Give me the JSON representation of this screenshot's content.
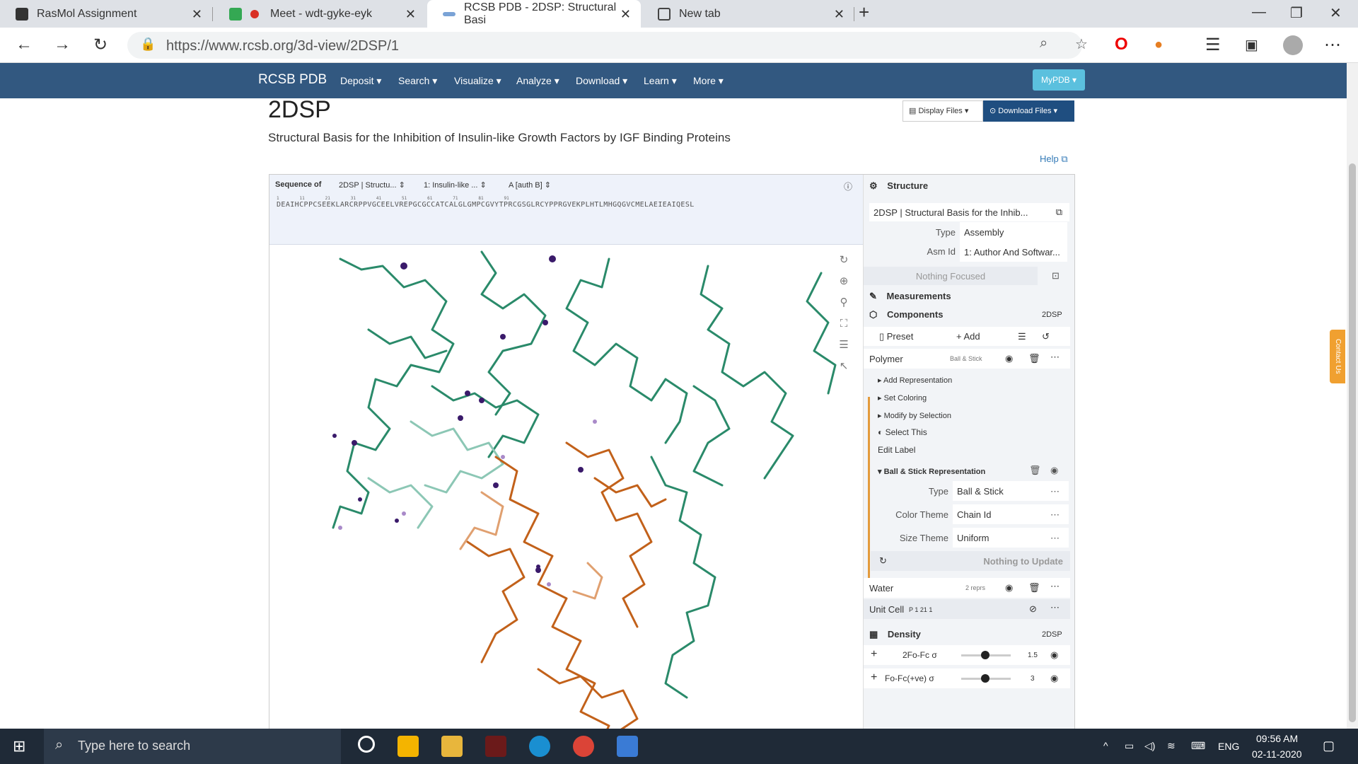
{
  "browser": {
    "tabs": [
      {
        "label": "RasMol Assignment"
      },
      {
        "label": "Meet - wdt-gyke-eyk"
      },
      {
        "label": "RCSB PDB - 2DSP: Structural Basi"
      },
      {
        "label": "New tab"
      }
    ],
    "url": "https://www.rcsb.org/3d-view/2DSP/1"
  },
  "sitenav": {
    "brand": "RCSB PDB",
    "items": [
      "Deposit ▾",
      "Search ▾",
      "Visualize ▾",
      "Analyze ▾",
      "Download ▾",
      "Learn ▾",
      "More ▾"
    ],
    "mypdb": "MyPDB ▾"
  },
  "page": {
    "title": "2DSP",
    "subtitle": "Structural Basis for the Inhibition of Insulin-like Growth Factors by IGF Binding Proteins",
    "display_files": "Display Files ▾",
    "download_files": "Download Files ▾",
    "help": "Help"
  },
  "sequence": {
    "label": "Sequence of",
    "entry": "2DSP | Structu...",
    "entity": "1: Insulin-like ...",
    "chain": "A [auth B]",
    "numbers": "1        11        21        31        41        51        61        71        81        91",
    "text": "DEAIHCPPCSEEKLARCRPPVGCEELVREPGCGCCATCALGLGMPCGVYTPRCGSGLRCYPPRGVEKPLHTLMHGQGVCMELAEIEAIQESL"
  },
  "panel": {
    "structure_header": "Structure",
    "structure_name": "2DSP | Structural Basis for the Inhib...",
    "type_label": "Type",
    "type_value": "Assembly",
    "asm_label": "Asm Id",
    "asm_value": "1: Author And Softwar...",
    "focus": "Nothing Focused",
    "measurements": "Measurements",
    "components": "Components",
    "components_tag": "2DSP",
    "preset": "Preset",
    "add": "+ Add",
    "polymer": "Polymer",
    "polymer_repr": "Ball & Stick",
    "add_repr": "Add Representation",
    "set_coloring": "Set Coloring",
    "modify_sel": "Modify by Selection",
    "select_this": "Select This",
    "edit_label": "Edit Label",
    "bs_repr": "Ball & Stick Representation",
    "r_type_label": "Type",
    "r_type_value": "Ball & Stick",
    "r_color_label": "Color Theme",
    "r_color_value": "Chain Id",
    "r_size_label": "Size Theme",
    "r_size_value": "Uniform",
    "nothing_update": "Nothing to Update",
    "water": "Water",
    "water_reprs": "2 reprs",
    "unit_cell": "Unit Cell",
    "unit_cell_sg": "P 1 21 1",
    "density": "Density",
    "density_tag": "2DSP",
    "d1_label": "2Fo-Fc σ",
    "d1_value": "1.5",
    "d2_label": "Fo-Fc(+ve) σ",
    "d2_value": "3"
  },
  "contact": "Contact Us",
  "taskbar": {
    "search": "Type here to search",
    "lang": "ENG",
    "time": "09:56 AM",
    "date": "02-11-2020"
  }
}
